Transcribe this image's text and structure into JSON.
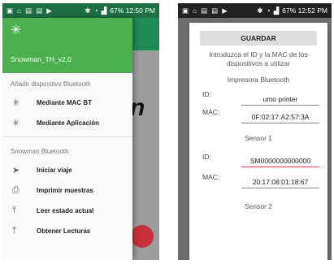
{
  "left": {
    "status": {
      "right_text": "67% 12:50 PM"
    },
    "header": {
      "bt_glyph": "✳",
      "title": "Snowman_TH_v2.0"
    },
    "main_title_fragment": "n",
    "sections": [
      {
        "label": "Añadir dispositivo Bluetooth",
        "items": [
          {
            "icon": "bluetooth-icon",
            "glyph": "✳",
            "label": "Mediante MAC BT"
          },
          {
            "icon": "bluetooth-icon",
            "glyph": "✳",
            "label": "Mediante Aplicación"
          }
        ]
      },
      {
        "label": "Snowman Bluetooth",
        "items": [
          {
            "icon": "send-icon",
            "glyph": "➤",
            "label": "Iniciar viaje"
          },
          {
            "icon": "printer-icon",
            "glyph": "⎙",
            "label": "Imprimir muestras"
          },
          {
            "icon": "upload-icon",
            "glyph": "⤒",
            "label": "Leer estado actual"
          },
          {
            "icon": "upload-icon",
            "glyph": "⤒",
            "label": "Obtener Lecturas"
          }
        ]
      }
    ]
  },
  "right": {
    "status": {
      "right_text": "67% 12:52 PM"
    },
    "dialog": {
      "save_label": "GUARDAR",
      "intro": "Introduzca el ID y la MAC de los dispositivos a utilizar",
      "printer_title": "Impresora Bluetooth",
      "id_label": "ID:",
      "mac_label": "MAC:",
      "printer_id": "umo printer",
      "printer_mac": "0F:02:17:A2:57:3A",
      "sensor1_title": "Sensor 1",
      "sensor1_id": "SM0000000000000",
      "sensor1_mac": "20:17:08:01:18:67",
      "sensor2_title": "Sensor 2"
    }
  }
}
